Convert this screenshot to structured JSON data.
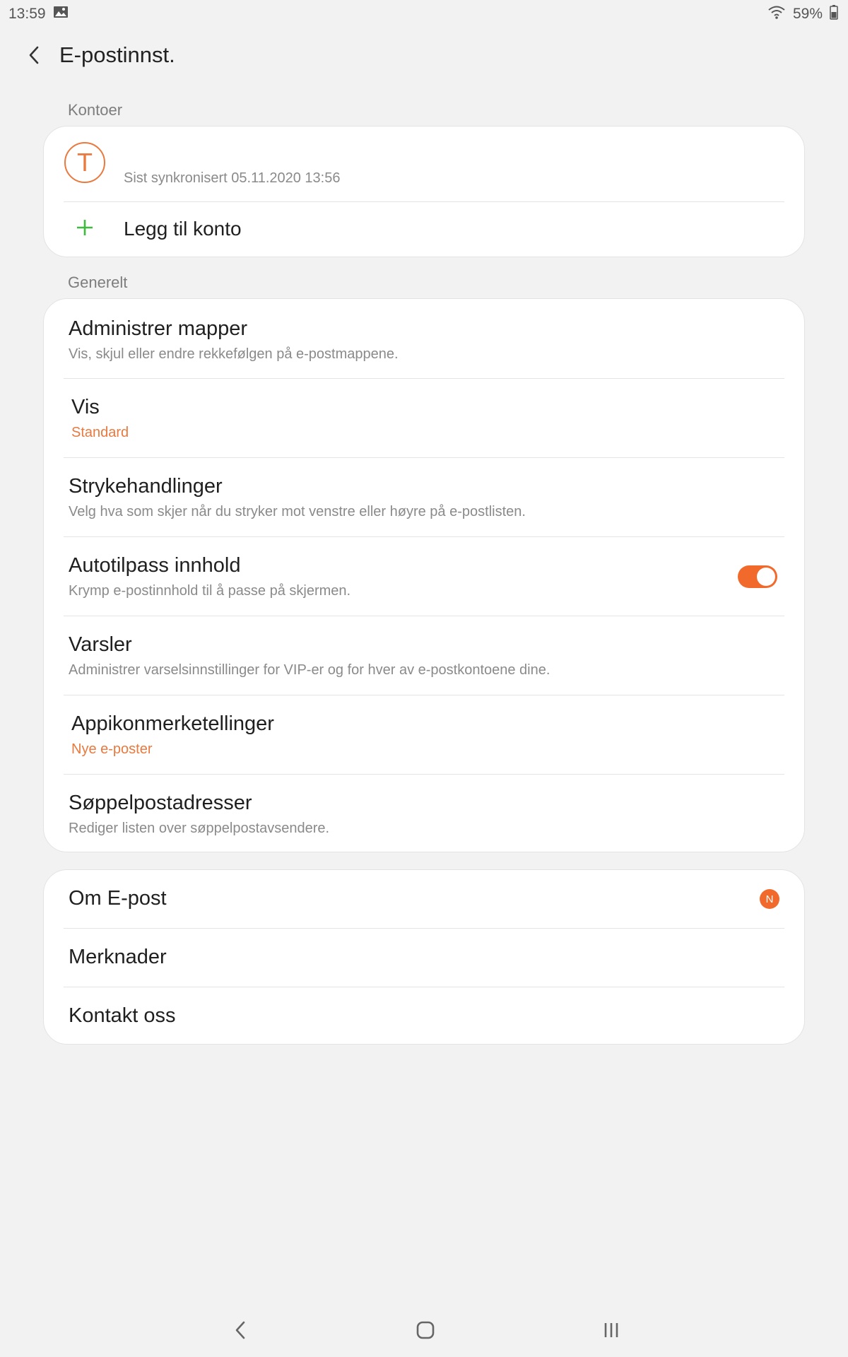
{
  "status_bar": {
    "time": "13:59",
    "battery": "59%",
    "icons": [
      "image-icon",
      "wifi-icon",
      "battery-icon"
    ]
  },
  "app_bar": {
    "title": "E-postinnst."
  },
  "accounts": {
    "section_label": "Kontoer",
    "avatar_letter": "T",
    "sync_text": "Sist synkronisert 05.11.2020  13:56",
    "add_account_label": "Legg til konto"
  },
  "general": {
    "section_label": "Generelt",
    "items": [
      {
        "title": "Administrer mapper",
        "subtitle": "Vis, skjul eller endre rekkefølgen på e-postmappene."
      },
      {
        "title": "Vis",
        "subtitle": "Standard"
      },
      {
        "title": "Strykehandlinger",
        "subtitle": "Velg hva som skjer når du stryker mot venstre eller høyre på e-postlisten."
      },
      {
        "title": "Autotilpass innhold",
        "subtitle": "Krymp e-postinnhold til å passe på skjermen.",
        "toggle": true
      },
      {
        "title": "Varsler",
        "subtitle": "Administrer varselsinnstillinger for VIP-er og for hver av e-postkontoene dine."
      },
      {
        "title": "Appikonmerketellinger",
        "subtitle": "Nye e-poster"
      },
      {
        "title": "Søppelpostadresser",
        "subtitle": "Rediger listen over søppelpostavsendere."
      }
    ]
  },
  "about": {
    "items": [
      {
        "title": "Om E-post",
        "badge": "N"
      },
      {
        "title": "Merknader"
      },
      {
        "title": "Kontakt oss"
      }
    ]
  },
  "colors": {
    "accent": "#e8793f",
    "toggle_on": "#f26a2b",
    "add_icon": "#3dbb3d"
  }
}
